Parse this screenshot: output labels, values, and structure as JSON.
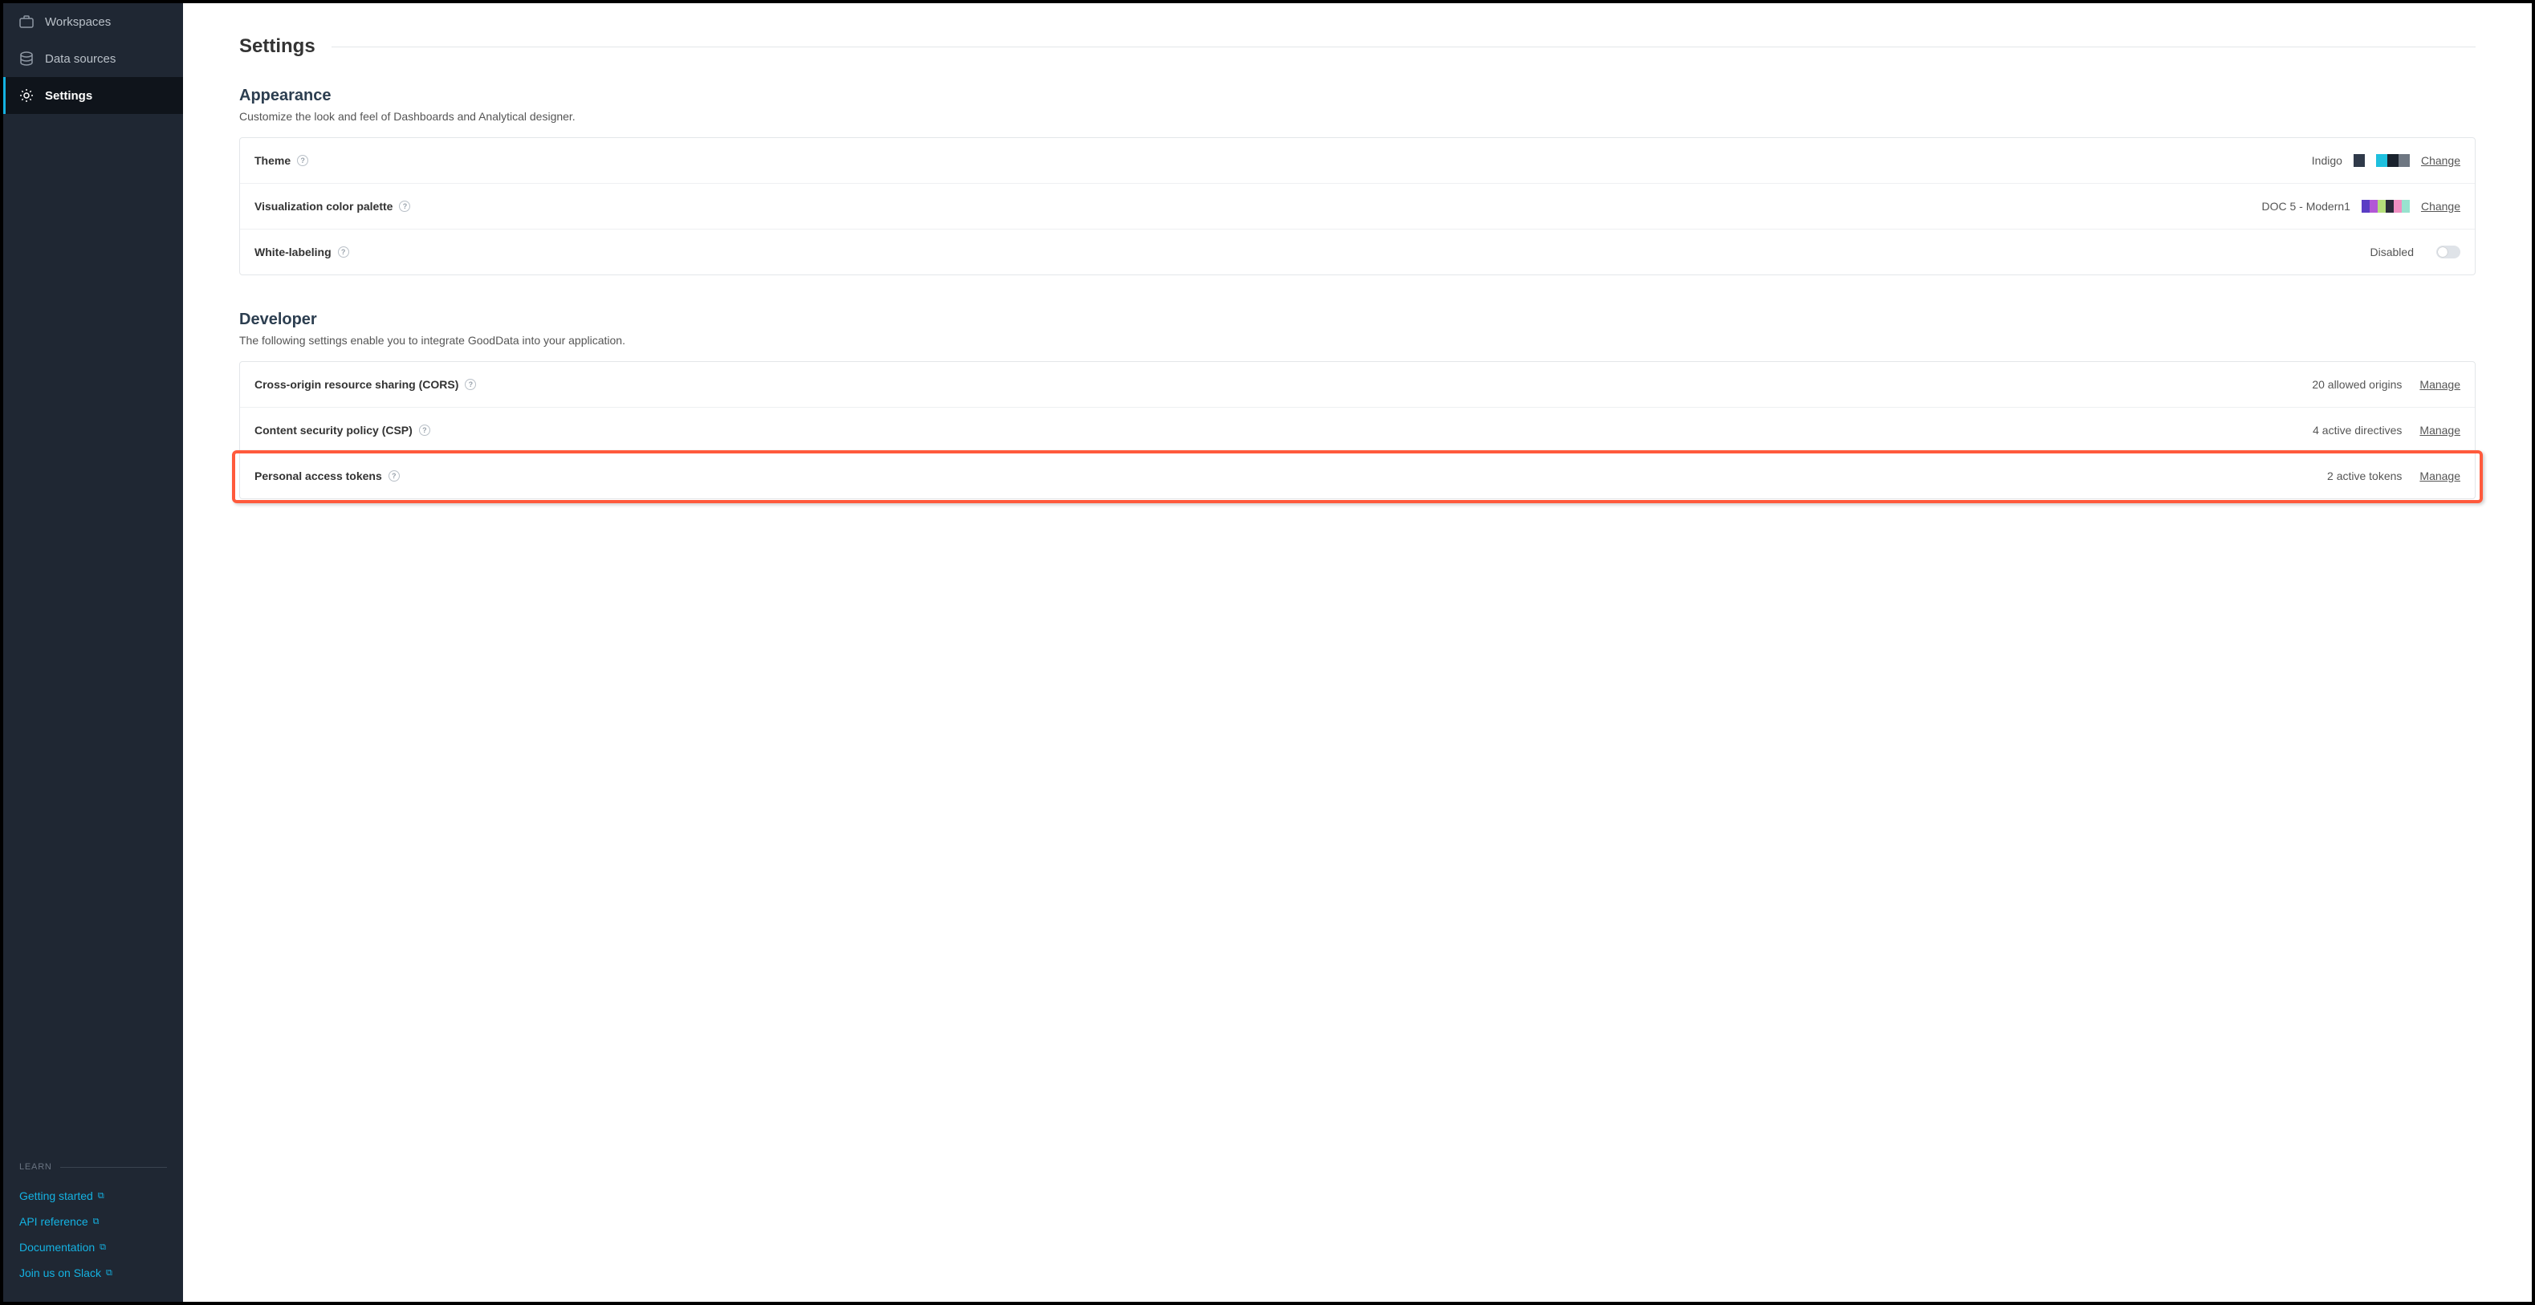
{
  "sidebar": {
    "items": [
      {
        "label": "Workspaces"
      },
      {
        "label": "Data sources"
      },
      {
        "label": "Settings"
      }
    ],
    "learn": {
      "header": "LEARN",
      "links": [
        {
          "label": "Getting started"
        },
        {
          "label": "API reference"
        },
        {
          "label": "Documentation"
        },
        {
          "label": "Join us on Slack"
        }
      ]
    }
  },
  "page": {
    "title": "Settings"
  },
  "sections": {
    "appearance": {
      "title": "Appearance",
      "desc": "Customize the look and feel of Dashboards and Analytical designer.",
      "rows": {
        "theme": {
          "label": "Theme",
          "value": "Indigo",
          "action": "Change",
          "swatches1": [
            "#303a4a"
          ],
          "swatches2": [
            "#1fc0de",
            "#1a232e",
            "#6e7782"
          ]
        },
        "palette": {
          "label": "Visualization color palette",
          "value": "DOC 5 - Modern1",
          "action": "Change",
          "swatches": [
            "#5a3dc4",
            "#b257d6",
            "#b4de7a",
            "#2a2a3a",
            "#f08fc2",
            "#98e3cf"
          ]
        },
        "whitelabel": {
          "label": "White-labeling",
          "value": "Disabled"
        }
      }
    },
    "developer": {
      "title": "Developer",
      "desc": "The following settings enable you to integrate GoodData into your application.",
      "rows": {
        "cors": {
          "label": "Cross-origin resource sharing (CORS)",
          "value": "20 allowed origins",
          "action": "Manage"
        },
        "csp": {
          "label": "Content security policy (CSP)",
          "value": "4 active directives",
          "action": "Manage"
        },
        "tokens": {
          "label": "Personal access tokens",
          "value": "2 active tokens",
          "action": "Manage"
        }
      }
    }
  }
}
